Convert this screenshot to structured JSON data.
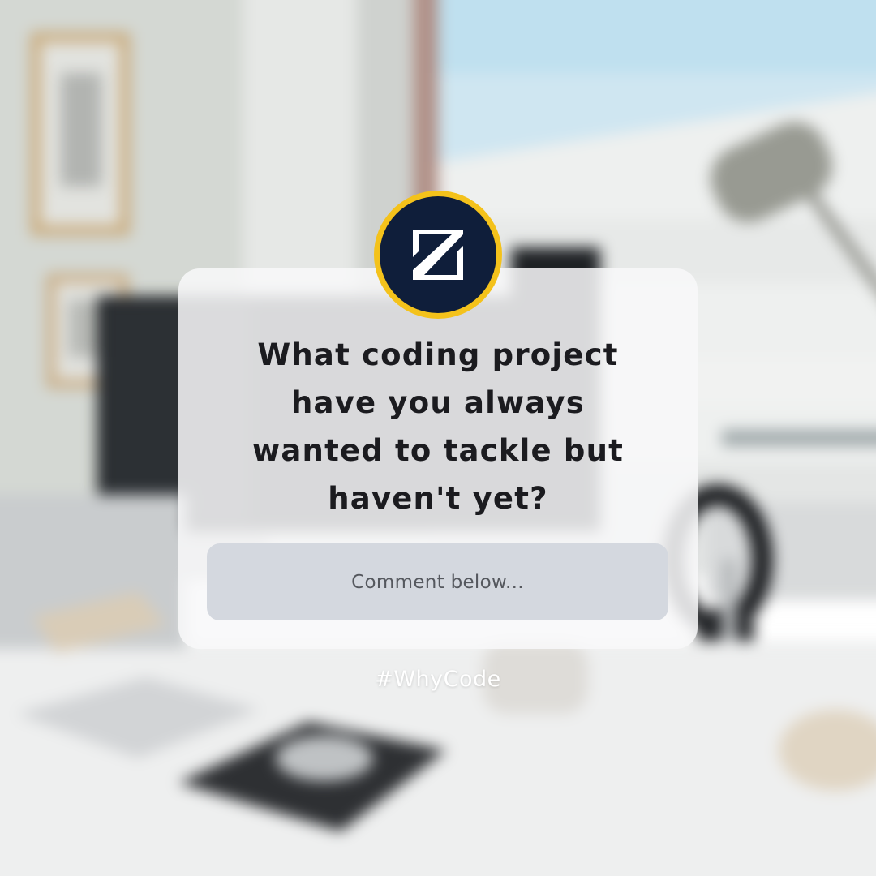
{
  "post": {
    "question_lines": [
      "What coding project",
      "have you always",
      "wanted to tackle but",
      "haven't yet?"
    ],
    "comment_placeholder": "Comment below...",
    "hashtag": "#WhyCode"
  },
  "logo": {
    "icon": "z-logo-icon",
    "ring_color": "#f4c21b",
    "fill_color": "#0f1e3a"
  },
  "background": {
    "scene": "blurred desk photo"
  }
}
